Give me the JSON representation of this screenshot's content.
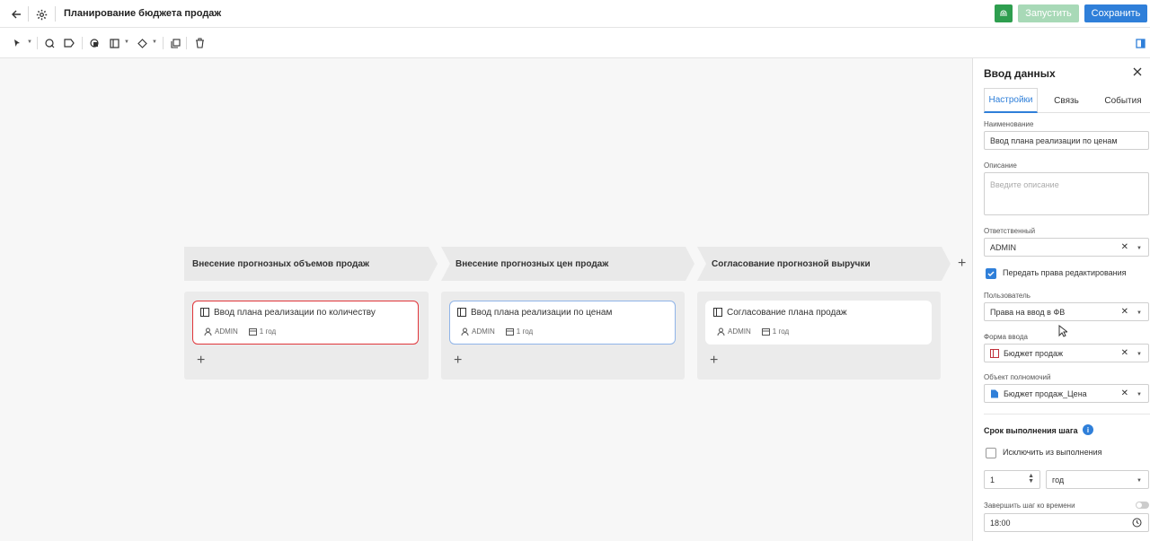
{
  "header": {
    "title": "Планирование бюджета продаж",
    "run_label": "Запустить",
    "save_label": "Сохранить"
  },
  "stages": [
    {
      "label": "Внесение прогнозных объемов продаж",
      "card": {
        "title": "Ввод плана реализации по количеству",
        "user": "ADMIN",
        "period": "1 год",
        "state": "error"
      }
    },
    {
      "label": "Внесение прогнозных цен продаж",
      "card": {
        "title": "Ввод плана реализации по ценам",
        "user": "ADMIN",
        "period": "1 год",
        "state": "selected"
      }
    },
    {
      "label": "Согласование прогнозной выручки",
      "card": {
        "title": "Согласование плана продаж",
        "user": "ADMIN",
        "period": "1 год",
        "state": "normal"
      }
    }
  ],
  "panel": {
    "title": "Ввод данных",
    "tabs": [
      "Настройки",
      "Связь",
      "События"
    ],
    "active_tab": "Настройки",
    "name_label": "Наименование",
    "name_value": "Ввод плана реализации по ценам",
    "description_label": "Описание",
    "description_placeholder": "Введите описание",
    "responsible_label": "Ответственный",
    "responsible_value": "ADMIN",
    "transfer_rights_label": "Передать права редактирования",
    "transfer_rights_checked": true,
    "user_label": "Пользователь",
    "user_value": "Права на ввод в ФВ",
    "form_label": "Форма ввода",
    "form_value": "Бюджет продаж",
    "authority_label": "Объект полномочий",
    "authority_value": "Бюджет продаж_Цена",
    "deadline_title": "Срок выполнения шага",
    "exclude_label": "Исключить из выполнения",
    "exclude_checked": false,
    "duration_value": "1",
    "duration_unit": "год",
    "finish_by_time_label": "Завершить шаг ко времени",
    "time_value": "18:00"
  },
  "colors": {
    "accent": "#2f7fd9",
    "green": "#2e9e4f",
    "error": "#e0353a"
  }
}
